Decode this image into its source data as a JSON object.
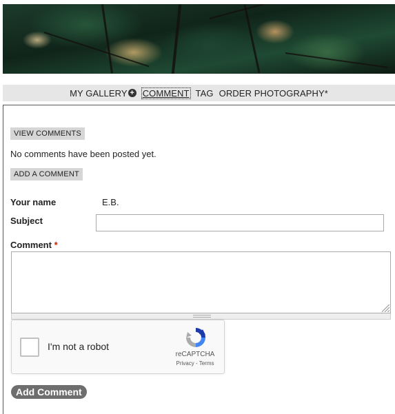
{
  "nav": {
    "items": [
      {
        "label": "MY GALLERY",
        "icon": "plus-circle-icon"
      },
      {
        "label": "COMMENT",
        "active": true
      },
      {
        "label": "TAG"
      },
      {
        "label": "ORDER PHOTOGRAPHY*"
      }
    ]
  },
  "comments": {
    "view_label": "VIEW COMMENTS",
    "empty_text": "No comments have been posted yet.",
    "add_label": "ADD A COMMENT"
  },
  "form": {
    "name_label": "Your name",
    "name_value": "E.B.",
    "subject_label": "Subject",
    "subject_value": "",
    "comment_label": "Comment",
    "required_marker": "*",
    "comment_value": "",
    "submit_label": "Add Comment"
  },
  "recaptcha": {
    "checkbox_label": "I'm not a robot",
    "brand": "reCAPTCHA",
    "links": "Privacy - Terms"
  },
  "colors": {
    "nav_bg": "#e6e6e6",
    "button_bg": "#d6d6d6",
    "submit_bg": "#6e6e6e",
    "required": "#cc2200"
  }
}
